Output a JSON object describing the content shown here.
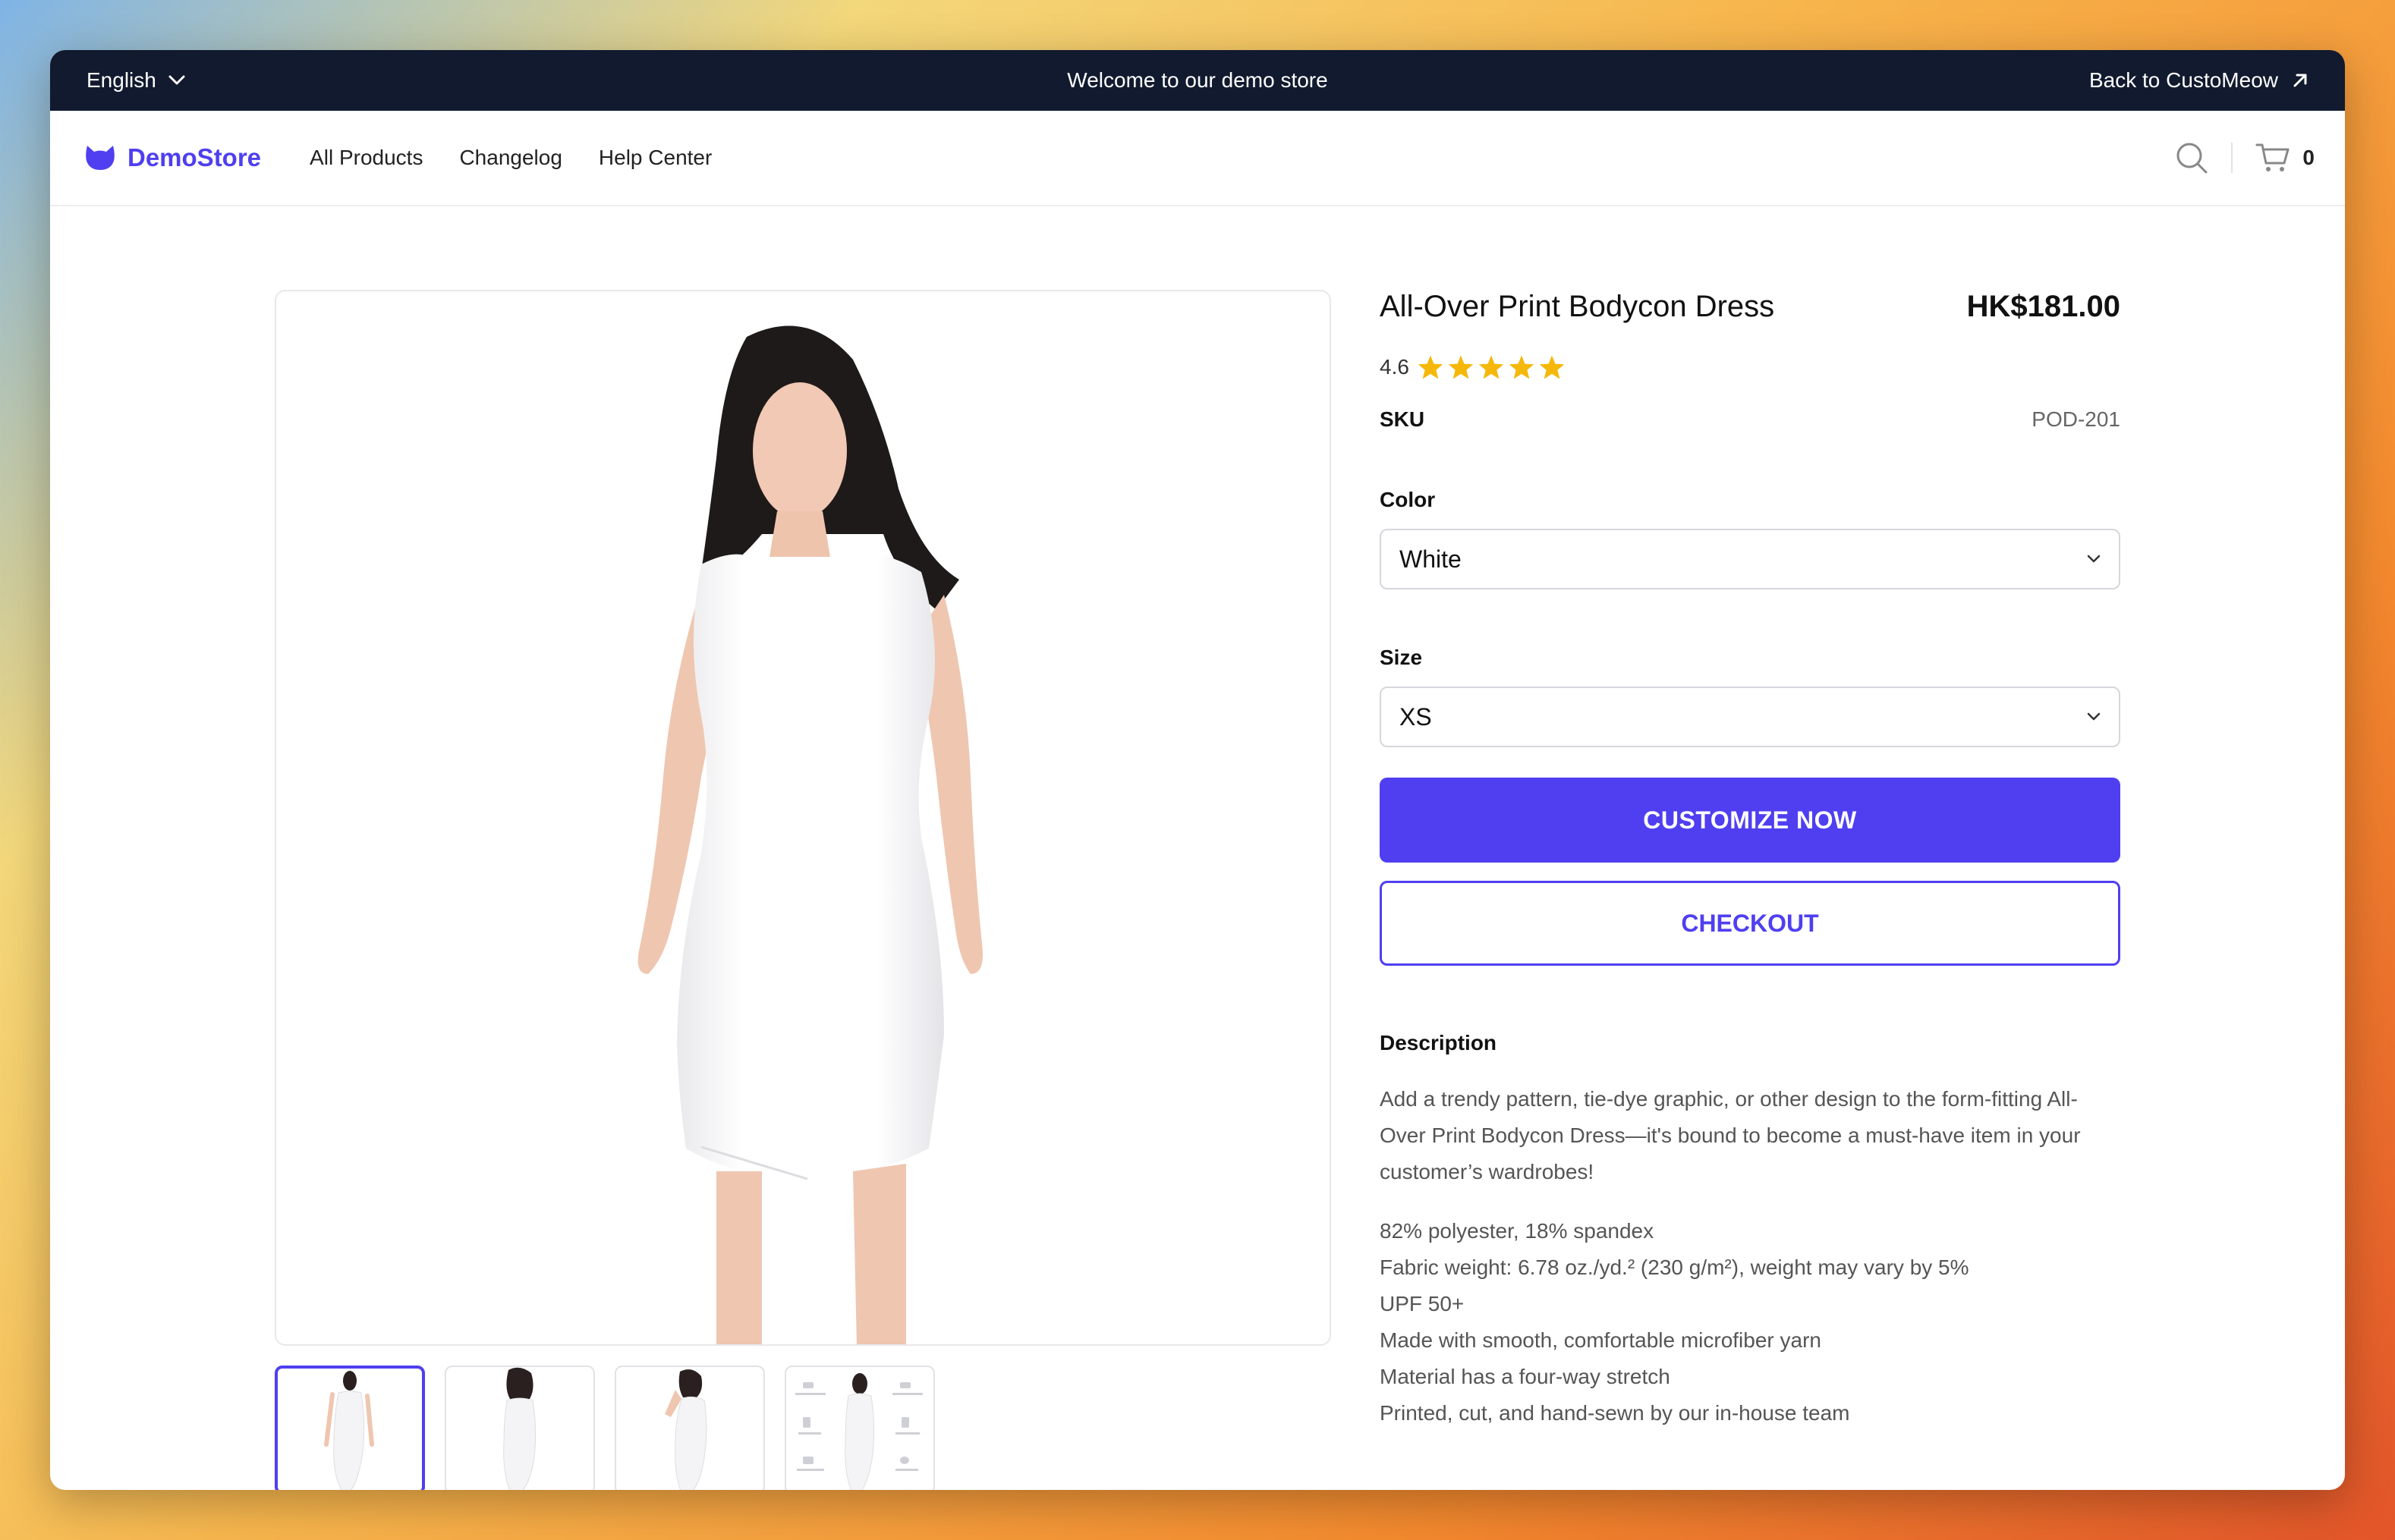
{
  "topbar": {
    "language": "English",
    "welcome": "Welcome to our demo store",
    "back_link": "Back to CustoMeow"
  },
  "nav": {
    "brand": "DemoStore",
    "links": [
      "All Products",
      "Changelog",
      "Help Center"
    ],
    "cart_count": "0"
  },
  "product": {
    "title": "All-Over Print Bodycon Dress",
    "price": "HK$181.00",
    "rating": "4.6",
    "stars": 5,
    "sku_label": "SKU",
    "sku_value": "POD-201",
    "color_label": "Color",
    "color_value": "White",
    "size_label": "Size",
    "size_value": "XS",
    "customize_label": "CUSTOMIZE NOW",
    "checkout_label": "CHECKOUT",
    "description_label": "Description",
    "description": "Add a trendy pattern, tie-dye graphic, or other design to the form-fitting All-Over Print Bodycon Dress—it's bound to become a must-have item in your customer’s wardrobes!",
    "features": [
      "82% polyester, 18% spandex",
      "Fabric weight: 6.78 oz./yd.² (230 g/m²), weight may vary by 5%",
      "UPF 50+",
      "Made with smooth, comfortable microfiber yarn",
      "Material has a four-way stretch",
      "Printed, cut, and hand-sewn by our in-house team"
    ],
    "thumbnail_count": 4
  },
  "colors": {
    "accent": "#4f3ff0",
    "topbar_bg": "#111a2e",
    "star": "#f5b80a"
  }
}
